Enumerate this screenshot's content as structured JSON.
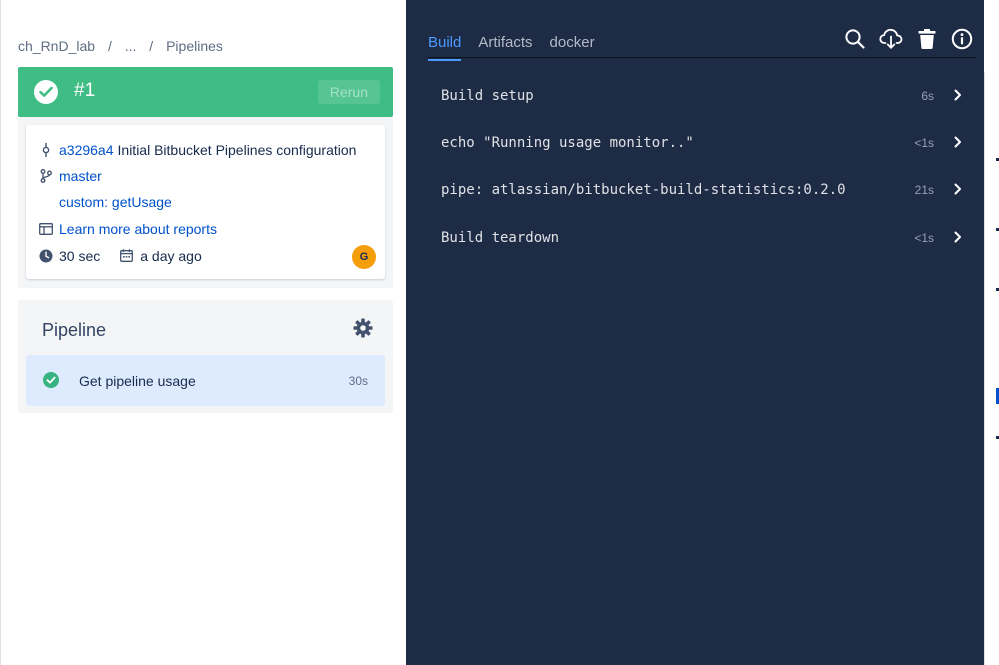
{
  "breadcrumb": {
    "workspace": "ch_RnD_lab",
    "sep1": "/",
    "ellipsis": "...",
    "sep2": "/",
    "current": "Pipelines"
  },
  "status": {
    "build_number": "#1",
    "rerun_label": "Rerun",
    "state_color": "#3fbd84",
    "icon": "check-circle-icon"
  },
  "commit": {
    "hash": "a3296a4",
    "message": "Initial Bitbucket Pipelines configuration",
    "branch": "master",
    "trigger": "custom: getUsage",
    "reports_link": "Learn more about reports",
    "duration": "30 sec",
    "when": "a day ago",
    "avatar_initial": "G"
  },
  "pipeline": {
    "title": "Pipeline",
    "steps": [
      {
        "label": "Get pipeline usage",
        "duration": "30s",
        "status": "success"
      }
    ]
  },
  "log": {
    "tabs": [
      {
        "label": "Build",
        "active": true
      },
      {
        "label": "Artifacts"
      },
      {
        "label": "docker"
      }
    ],
    "toolbar": [
      "search-icon",
      "cloud-download-icon",
      "trash-icon",
      "info-icon"
    ],
    "rows": [
      {
        "label": "Build setup",
        "duration": "6s"
      },
      {
        "label": "echo \"Running usage monitor..\"",
        "duration": "<1s"
      },
      {
        "label": "pipe: atlassian/bitbucket-build-statistics:0.2.0",
        "duration": "21s"
      },
      {
        "label": "Build teardown",
        "duration": "<1s"
      }
    ]
  },
  "colors": {
    "accent": "#4c9aff",
    "panel_dark": "#1e2b45",
    "success": "#3fbd84",
    "link": "#0052cc"
  }
}
